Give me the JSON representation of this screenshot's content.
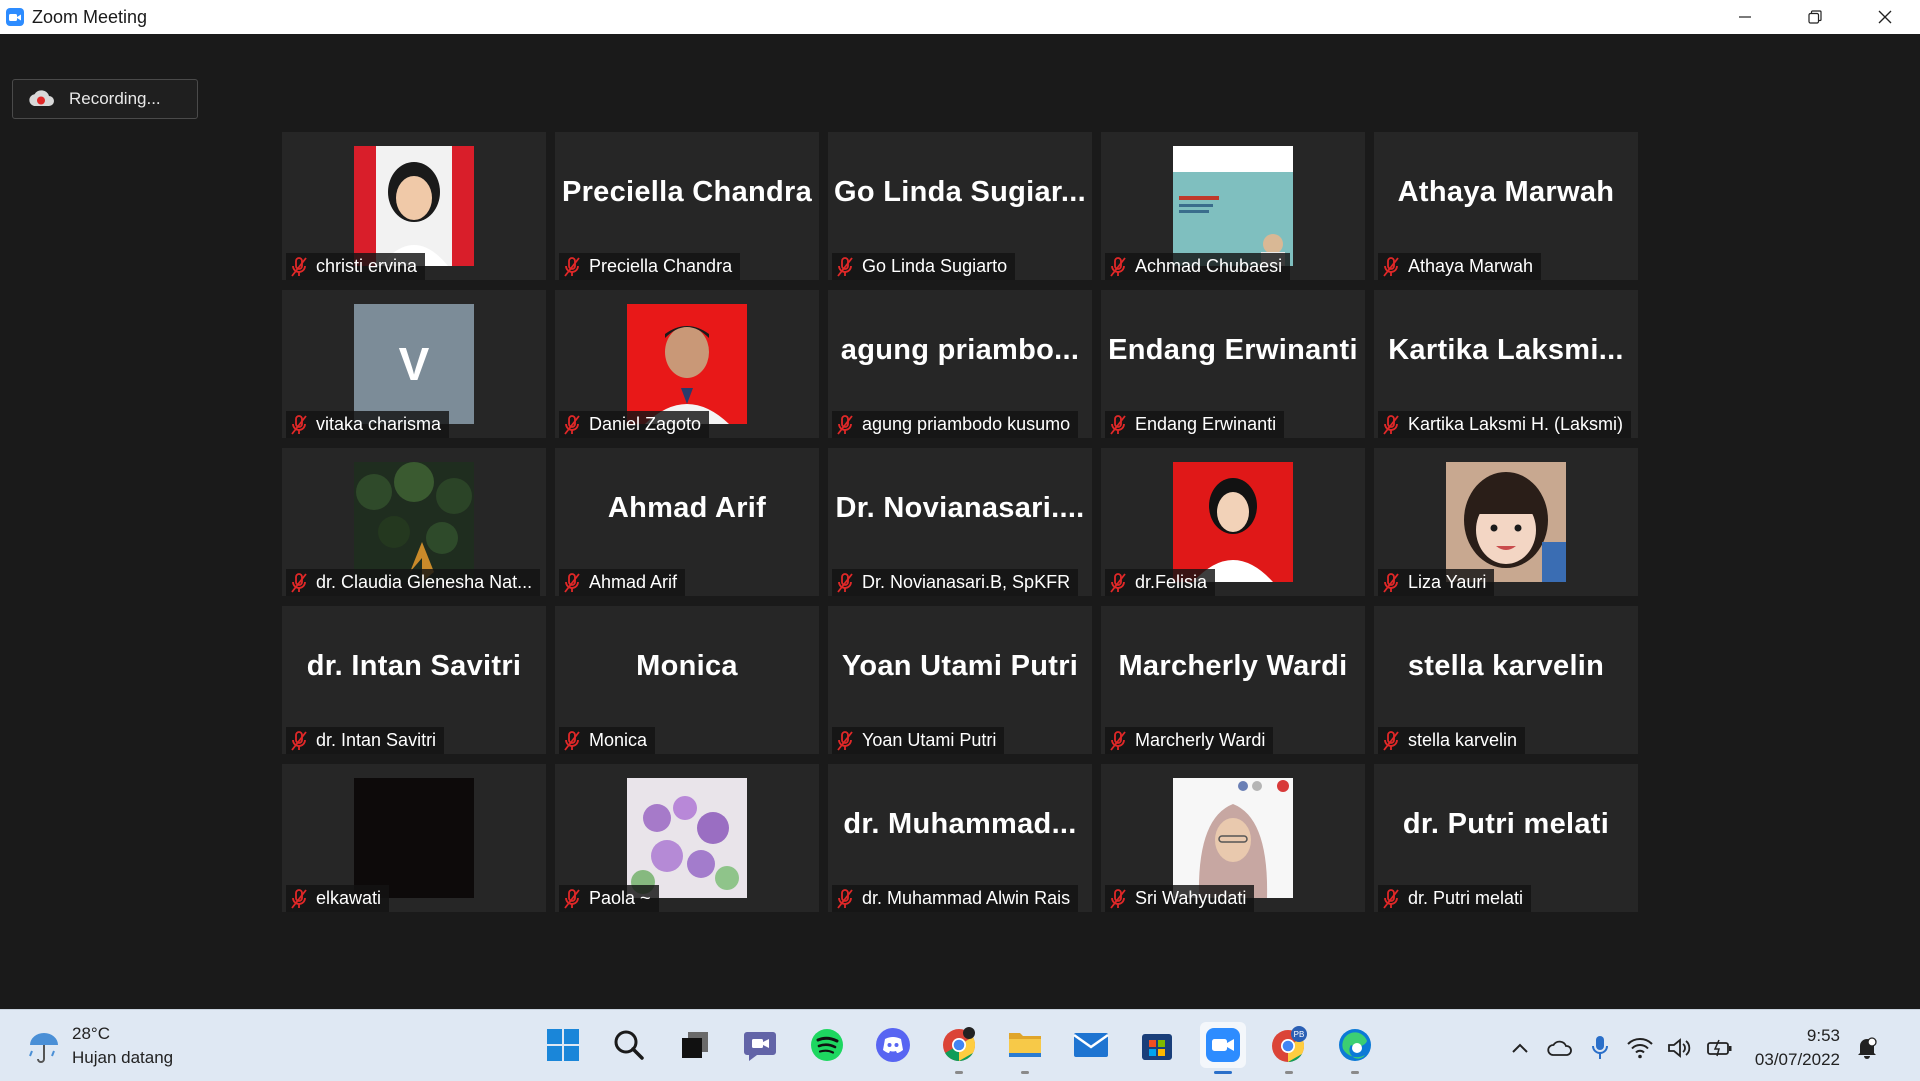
{
  "window": {
    "title": "Zoom Meeting"
  },
  "recording": {
    "label": "Recording..."
  },
  "participants": [
    {
      "name": "christi ervina",
      "display": "",
      "avatar": "photo-red"
    },
    {
      "name": "Preciella Chandra",
      "display": "Preciella Chandra",
      "avatar": ""
    },
    {
      "name": "Go Linda Sugiarto",
      "display": "Go Linda Sugiar...",
      "avatar": ""
    },
    {
      "name": "Achmad Chubaesi",
      "display": "",
      "avatar": "photo-slide"
    },
    {
      "name": "Athaya Marwah",
      "display": "Athaya Marwah",
      "avatar": ""
    },
    {
      "name": "vitaka charisma",
      "display": "",
      "avatar": "letter",
      "letter": "V"
    },
    {
      "name": "Daniel Zagoto",
      "display": "",
      "avatar": "photo-red-man"
    },
    {
      "name": "agung priambodo kusumo",
      "display": "agung  priambo...",
      "avatar": ""
    },
    {
      "name": "Endang Erwinanti",
      "display": "Endang Erwinanti",
      "avatar": ""
    },
    {
      "name": "Kartika Laksmi H. (Laksmi)",
      "display": "Kartika  Laksmi...",
      "avatar": ""
    },
    {
      "name": "dr. Claudia Glenesha Nat...",
      "display": "",
      "avatar": "photo-forest"
    },
    {
      "name": "Ahmad Arif",
      "display": "Ahmad Arif",
      "avatar": ""
    },
    {
      "name": "Dr. Novianasari.B, SpKFR",
      "display": "Dr.  Novianasari....",
      "avatar": ""
    },
    {
      "name": "dr.Felisia",
      "display": "",
      "avatar": "photo-red-woman"
    },
    {
      "name": "Liza Yauri",
      "display": "",
      "avatar": "photo-child"
    },
    {
      "name": "dr. Intan Savitri",
      "display": "dr. Intan Savitri",
      "avatar": ""
    },
    {
      "name": "Monica",
      "display": "Monica",
      "avatar": ""
    },
    {
      "name": "Yoan Utami Putri",
      "display": "Yoan Utami Putri",
      "avatar": ""
    },
    {
      "name": "Marcherly Wardi",
      "display": "Marcherly Wardi",
      "avatar": ""
    },
    {
      "name": "stella karvelin",
      "display": "stella karvelin",
      "avatar": ""
    },
    {
      "name": "elkawati",
      "display": "",
      "avatar": "photo-black"
    },
    {
      "name": "Paola ~",
      "display": "",
      "avatar": "photo-flowers"
    },
    {
      "name": "dr. Muhammad Alwin Rais",
      "display": "dr.  Muhammad...",
      "avatar": ""
    },
    {
      "name": "Sri Wahyudati",
      "display": "",
      "avatar": "photo-hijab"
    },
    {
      "name": "dr. Putri melati",
      "display": "dr. Putri melati",
      "avatar": ""
    }
  ],
  "taskbar": {
    "weather_temp": "28°C",
    "weather_desc": "Hujan datang",
    "apps": [
      "windows-start-icon",
      "search-icon",
      "task-view-icon",
      "teams-chat-icon",
      "spotify-icon",
      "discord-icon",
      "chrome-icon",
      "file-explorer-icon",
      "mail-icon",
      "microsoft-store-icon",
      "zoom-icon",
      "chrome-profile-icon",
      "edge-icon"
    ],
    "time": "9:53",
    "date": "03/07/2022"
  },
  "colors": {
    "zoom_blue": "#2d8cff",
    "mute_red": "#e02828",
    "tile_bg": "#262626"
  }
}
